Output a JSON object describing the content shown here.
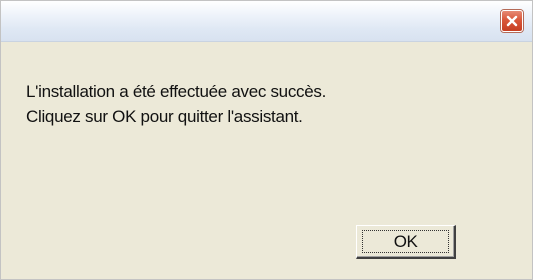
{
  "window": {
    "title": "",
    "close_icon": "close-icon"
  },
  "message": {
    "line1": "L'installation a été effectuée avec succès.",
    "line2": "Cliquez sur OK pour quitter l'assistant."
  },
  "buttons": {
    "ok_label": "OK"
  },
  "colors": {
    "dialog_bg": "#ece9d8",
    "close_button": "#d9573a"
  }
}
